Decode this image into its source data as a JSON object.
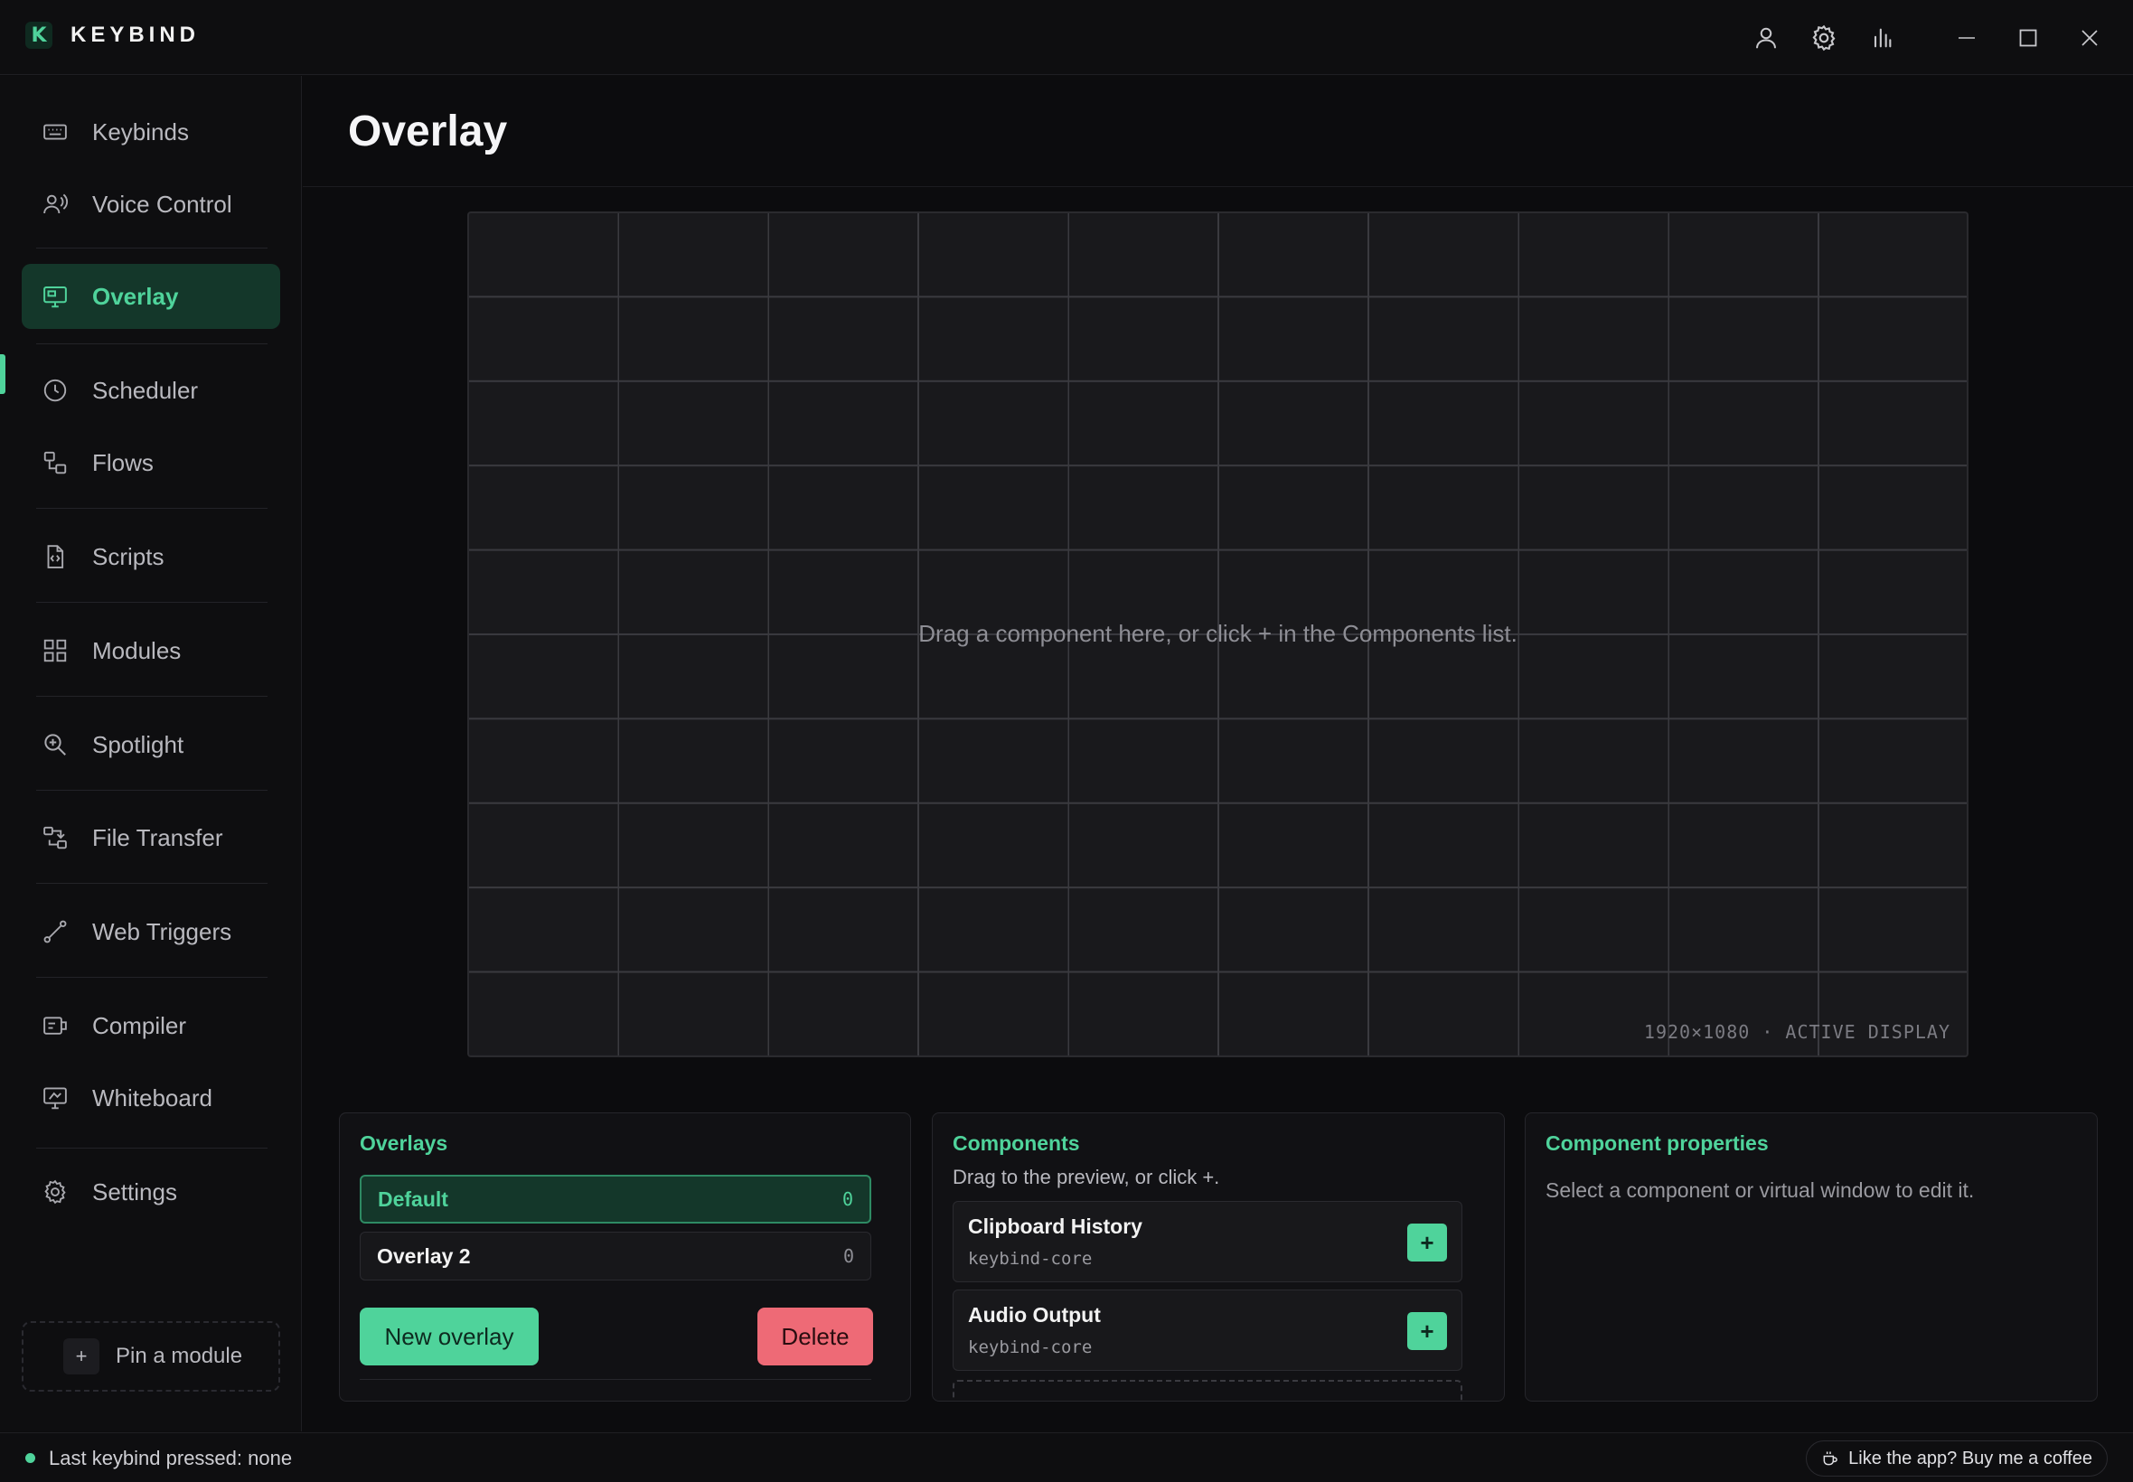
{
  "app": {
    "name": "KEYBIND",
    "logo_letter": "K"
  },
  "titlebar": {
    "icons": [
      "user-icon",
      "gear-icon",
      "stats-icon",
      "minimize-icon",
      "maximize-icon",
      "close-icon"
    ]
  },
  "sidebar": {
    "items": [
      {
        "label": "Keybinds",
        "icon": "keyboard-icon"
      },
      {
        "label": "Voice Control",
        "icon": "voice-icon"
      },
      {
        "label": "Overlay",
        "icon": "monitor-icon",
        "active": true
      },
      {
        "label": "Scheduler",
        "icon": "clock-icon"
      },
      {
        "label": "Flows",
        "icon": "flow-icon"
      },
      {
        "label": "Scripts",
        "icon": "script-file-icon"
      },
      {
        "label": "Modules",
        "icon": "grid-icon"
      },
      {
        "label": "Spotlight",
        "icon": "search-zoom-icon"
      },
      {
        "label": "File Transfer",
        "icon": "transfer-icon"
      },
      {
        "label": "Web Triggers",
        "icon": "webhook-icon"
      },
      {
        "label": "Compiler",
        "icon": "compiler-icon"
      },
      {
        "label": "Whiteboard",
        "icon": "whiteboard-icon"
      },
      {
        "label": "Settings",
        "icon": "gear-icon"
      }
    ],
    "pin_module": {
      "plus": "+",
      "label": "Pin a module"
    }
  },
  "page": {
    "title": "Overlay"
  },
  "preview": {
    "hint": "Drag a component here, or click + in the Components list.",
    "resolution": "1920×1080 · ACTIVE DISPLAY"
  },
  "overlays_panel": {
    "title": "Overlays",
    "items": [
      {
        "name": "Default",
        "count": "0",
        "selected": true
      },
      {
        "name": "Overlay 2",
        "count": "0",
        "selected": false
      }
    ],
    "new_label": "New overlay",
    "delete_label": "Delete"
  },
  "components_panel": {
    "title": "Components",
    "subtitle": "Drag to the preview, or click +.",
    "items": [
      {
        "name": "Clipboard History",
        "source": "keybind-core",
        "add": "+"
      },
      {
        "name": "Audio Output",
        "source": "keybind-core",
        "add": "+"
      }
    ]
  },
  "properties_panel": {
    "title": "Component properties",
    "empty_text": "Select a component or virtual window to edit it."
  },
  "statusbar": {
    "last_keybind": "Last keybind pressed: none",
    "coffee_label": "Like the app? Buy me a coffee"
  },
  "colors": {
    "accent": "#4fd39b",
    "danger": "#ee6a76",
    "background": "#0c0c0e"
  }
}
